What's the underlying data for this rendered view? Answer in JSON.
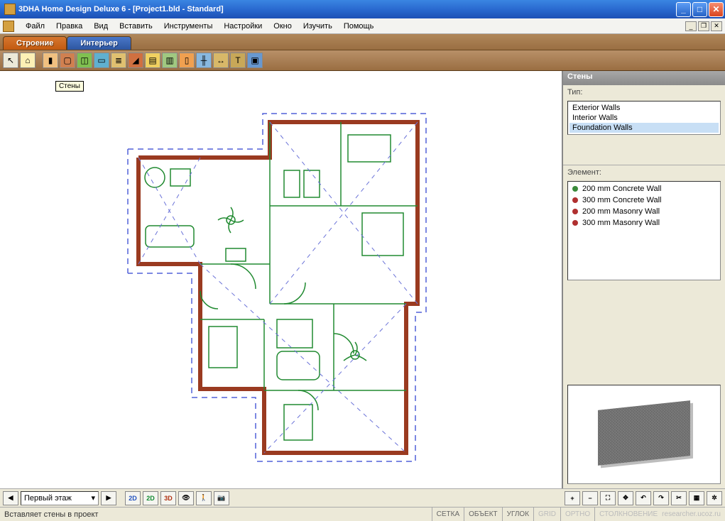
{
  "window": {
    "title": "3DHA Home Design Deluxe 6 - [Project1.bld - Standard]"
  },
  "menu": {
    "file": "Файл",
    "edit": "Правка",
    "view": "Вид",
    "insert": "Вставить",
    "tools": "Инструменты",
    "settings": "Настройки",
    "window": "Окно",
    "learn": "Изучить",
    "help": "Помощь"
  },
  "tabs": {
    "building": "Строение",
    "interior": "Интерьер"
  },
  "canvas": {
    "tooltip": "Стены"
  },
  "side": {
    "header": "Стены",
    "type_label": "Тип:",
    "types": [
      "Exterior Walls",
      "Interior Walls",
      "Foundation Walls"
    ],
    "type_selected_index": 2,
    "element_label": "Элемент:",
    "elements": [
      {
        "name": "200 mm Concrete Wall",
        "dot": "g"
      },
      {
        "name": "300 mm Concrete Wall",
        "dot": "r"
      },
      {
        "name": "200 mm Masonry Wall",
        "dot": "r"
      },
      {
        "name": "300 mm Masonry Wall",
        "dot": "r"
      }
    ]
  },
  "viewbar": {
    "floor": "Первый этаж",
    "btn2d": "2D",
    "btn2dshade": "2D",
    "btn3d": "3D"
  },
  "status": {
    "message": "Вставляет стены в проект",
    "cells": [
      "СЕТКА",
      "ОБЪЕКТ",
      "УГЛОК",
      "GRID",
      "ОРТНО",
      "СТОЛКНОВЕНИЕ"
    ],
    "watermark": "researcher.ucoz.ru"
  }
}
